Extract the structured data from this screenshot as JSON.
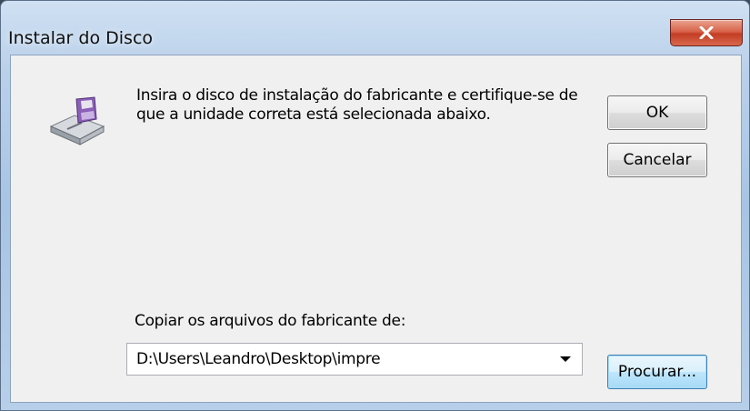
{
  "window": {
    "title": "Instalar do Disco"
  },
  "titlebar": {
    "close_icon": "close-icon"
  },
  "dialog": {
    "icon": "floppy-disk-drive-icon",
    "instruction": "Insira o disco de instalação do fabricante e certifique-se de que a unidade correta está selecionada abaixo.",
    "ok_label": "OK",
    "cancel_label": "Cancelar",
    "copy_label": "Copiar os arquivos do fabricante de:",
    "path_value": "D:\\Users\\Leandro\\Desktop\\impre",
    "browse_label": "Procurar..."
  },
  "colors": {
    "close_button": "#c33d24",
    "focus_button_border": "#3c7fb1"
  }
}
